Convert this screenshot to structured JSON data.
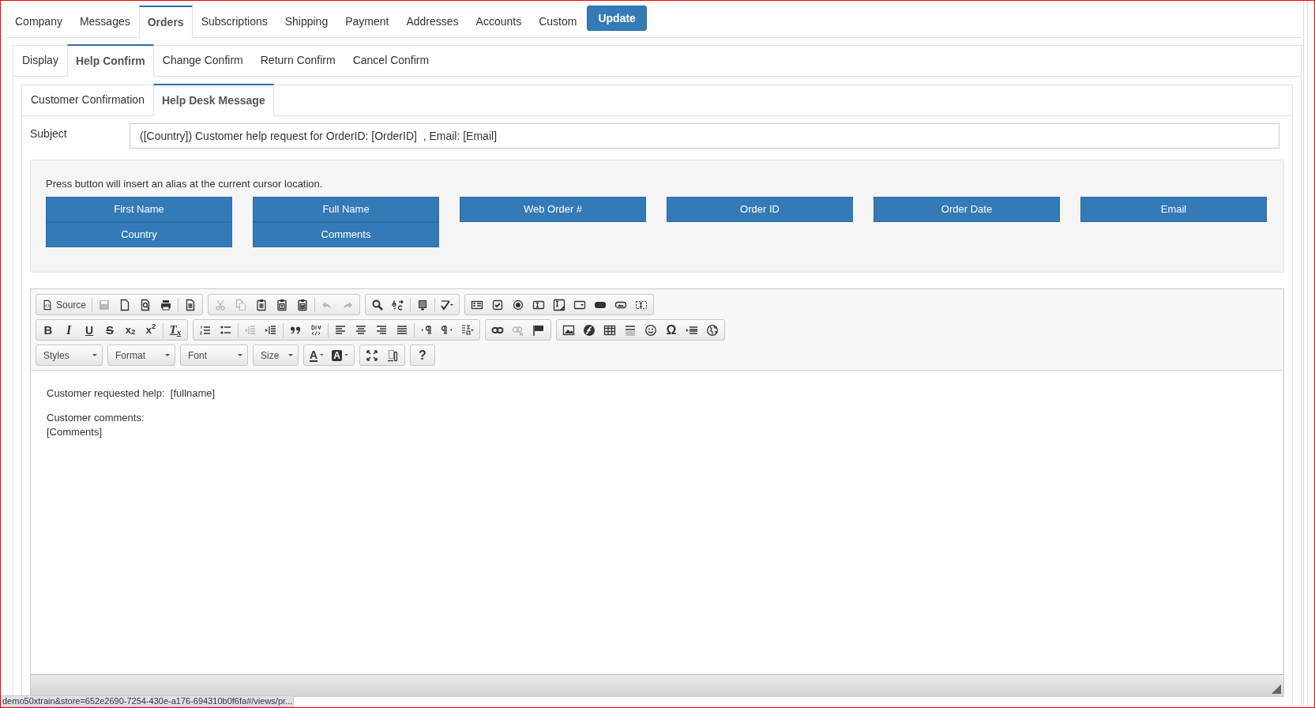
{
  "main_tabs": [
    {
      "label": "Company",
      "selected": false
    },
    {
      "label": "Messages",
      "selected": false
    },
    {
      "label": "Orders",
      "selected": true
    },
    {
      "label": "Subscriptions",
      "selected": false
    },
    {
      "label": "Shipping",
      "selected": false
    },
    {
      "label": "Payment",
      "selected": false
    },
    {
      "label": "Addresses",
      "selected": false
    },
    {
      "label": "Accounts",
      "selected": false
    },
    {
      "label": "Custom",
      "selected": false
    }
  ],
  "update_button": {
    "label": "Update"
  },
  "sub_tabs": [
    {
      "label": "Display",
      "selected": false
    },
    {
      "label": "Help Confirm",
      "selected": true
    },
    {
      "label": "Change Confirm",
      "selected": false
    },
    {
      "label": "Return Confirm",
      "selected": false
    },
    {
      "label": "Cancel Confirm",
      "selected": false
    }
  ],
  "message_tabs": [
    {
      "label": "Customer Confirmation",
      "selected": false
    },
    {
      "label": "Help Desk Message",
      "selected": true
    }
  ],
  "subject": {
    "label": "Subject",
    "value": "([Country]) Customer help request for OrderID: [OrderID]  , Email: [Email]"
  },
  "alias_panel": {
    "hint": "Press button will insert an alias at the current cursor location.",
    "columns": [
      [
        "First Name",
        "Country"
      ],
      [
        "Full Name",
        "Comments"
      ],
      [
        "Web Order #"
      ],
      [
        "Order ID"
      ],
      [
        "Order Date"
      ],
      [
        "Email"
      ]
    ]
  },
  "editor": {
    "toolbar_rows": [
      [
        [
          {
            "kind": "source",
            "label": "Source",
            "disabled": false
          },
          {
            "kind": "separator"
          },
          {
            "kind": "icon",
            "disabled": true
          },
          {
            "kind": "icon",
            "disabled": false
          },
          {
            "kind": "icon",
            "disabled": false
          },
          {
            "kind": "icon",
            "disabled": false
          },
          {
            "kind": "separator"
          },
          {
            "kind": "icon",
            "disabled": false
          }
        ],
        [
          {
            "kind": "icon",
            "disabled": true
          },
          {
            "kind": "icon",
            "disabled": true
          },
          {
            "kind": "icon",
            "disabled": false
          },
          {
            "kind": "icon",
            "disabled": false
          },
          {
            "kind": "icon",
            "disabled": false
          },
          {
            "kind": "separator"
          },
          {
            "kind": "icon",
            "disabled": true
          },
          {
            "kind": "icon",
            "disabled": true
          }
        ],
        [
          {
            "kind": "icon",
            "disabled": false
          },
          {
            "kind": "icon",
            "disabled": false
          },
          {
            "kind": "separator"
          },
          {
            "kind": "icon",
            "disabled": false
          },
          {
            "kind": "separator"
          },
          {
            "kind": "icon",
            "disabled": false
          }
        ],
        [
          {
            "kind": "icon",
            "disabled": false
          },
          {
            "kind": "icon",
            "disabled": false
          },
          {
            "kind": "icon",
            "disabled": false
          },
          {
            "kind": "icon",
            "disabled": false
          },
          {
            "kind": "icon",
            "disabled": false
          },
          {
            "kind": "icon",
            "disabled": false
          },
          {
            "kind": "icon",
            "disabled": false
          },
          {
            "kind": "icon",
            "disabled": false
          },
          {
            "kind": "icon",
            "disabled": false
          }
        ]
      ],
      [
        [
          {
            "kind": "bold",
            "label": "B",
            "disabled": false
          },
          {
            "kind": "italic",
            "label": "I",
            "disabled": false
          },
          {
            "kind": "underline",
            "label": "U",
            "disabled": false
          },
          {
            "kind": "strike",
            "label": "S",
            "disabled": false
          },
          {
            "kind": "script",
            "label": "x$_{2}$",
            "disabled": false
          },
          {
            "kind": "script",
            "label": "x$^{2}$",
            "disabled": false
          },
          {
            "kind": "separator"
          },
          {
            "kind": "removeformat",
            "label": "T$_{x}$",
            "disabled": false
          }
        ],
        [
          {
            "kind": "icon",
            "disabled": false
          },
          {
            "kind": "icon",
            "disabled": false
          },
          {
            "kind": "separator"
          },
          {
            "kind": "icon",
            "disabled": true
          },
          {
            "kind": "icon",
            "disabled": false
          },
          {
            "kind": "separator"
          },
          {
            "kind": "icon",
            "disabled": false
          },
          {
            "kind": "icon",
            "disabled": false
          },
          {
            "kind": "separator"
          },
          {
            "kind": "icon",
            "disabled": false
          },
          {
            "kind": "icon",
            "disabled": false
          },
          {
            "kind": "icon",
            "disabled": false
          },
          {
            "kind": "icon",
            "disabled": false
          },
          {
            "kind": "separator"
          },
          {
            "kind": "icon",
            "disabled": false
          },
          {
            "kind": "icon",
            "disabled": false
          },
          {
            "kind": "icon",
            "disabled": false
          }
        ],
        [
          {
            "kind": "icon",
            "disabled": false
          },
          {
            "kind": "icon",
            "disabled": true
          },
          {
            "kind": "icon",
            "disabled": false
          }
        ],
        [
          {
            "kind": "icon",
            "disabled": false
          },
          {
            "kind": "icon",
            "disabled": false
          },
          {
            "kind": "icon",
            "disabled": false
          },
          {
            "kind": "icon",
            "disabled": false
          },
          {
            "kind": "icon",
            "disabled": false
          },
          {
            "kind": "char",
            "label": "Ω",
            "disabled": false
          },
          {
            "kind": "icon",
            "disabled": false
          },
          {
            "kind": "icon",
            "disabled": false
          }
        ]
      ],
      [
        [
          {
            "kind": "combo",
            "label": "Styles",
            "disabled": false
          }
        ],
        [
          {
            "kind": "combo",
            "label": "Format",
            "disabled": false
          }
        ],
        [
          {
            "kind": "combo",
            "label": "Font",
            "disabled": false
          }
        ],
        [
          {
            "kind": "combo",
            "label": "Size",
            "disabled": false
          }
        ],
        [
          {
            "kind": "color-text",
            "label": "A",
            "disabled": false
          },
          {
            "kind": "color-bg",
            "label": "A",
            "disabled": false
          }
        ],
        [
          {
            "kind": "icon",
            "disabled": false
          },
          {
            "kind": "icon",
            "disabled": false
          }
        ],
        [
          {
            "kind": "char",
            "label": "?",
            "disabled": false
          }
        ]
      ]
    ],
    "content": [
      {
        "kind": "para",
        "lines": [
          "Customer requested help:  [fullname]"
        ]
      },
      {
        "kind": "para",
        "lines": [
          "Customer comments:",
          "[Comments]"
        ]
      }
    ]
  },
  "status_url": "demo50xtrain&store=652e2690-7254-430e-a176-694310b0f6fa#/views/pr..."
}
